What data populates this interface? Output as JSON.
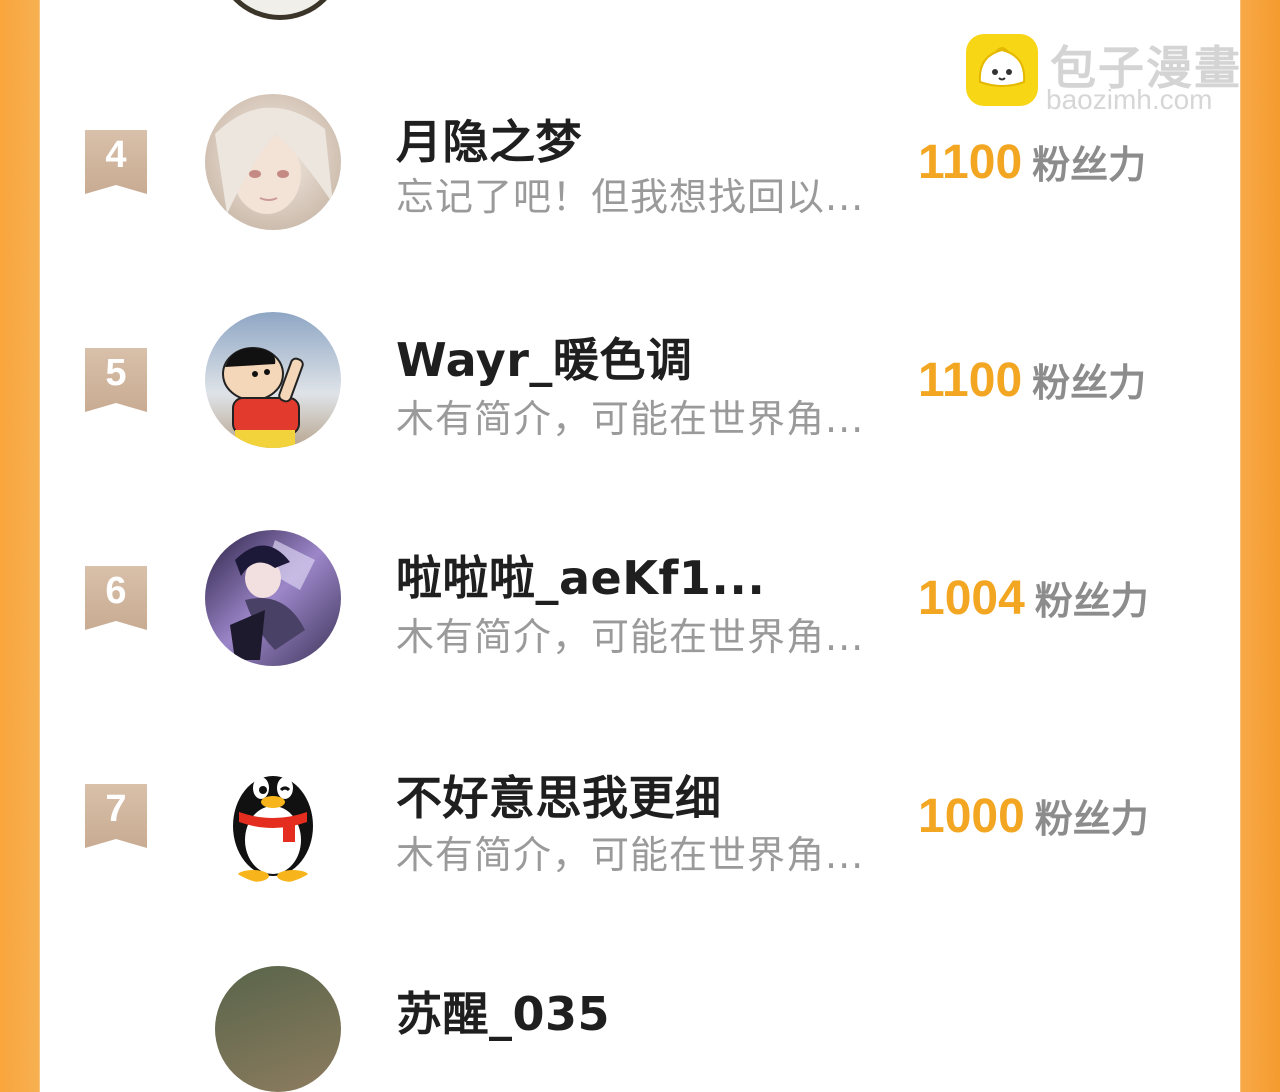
{
  "watermark": {
    "title": "包子漫畫",
    "domain": "baozimh.com"
  },
  "fans_label": "粉丝力",
  "rows": [
    {
      "rank": "4",
      "name": "月隐之梦",
      "bio": "忘记了吧！但我想找回以...",
      "fans": "1100",
      "avatar": "anime-girl-white-hair-avatar"
    },
    {
      "rank": "5",
      "name": "Wayr_暖色调",
      "bio": "木有简介，可能在世界角...",
      "fans": "1100",
      "avatar": "crayon-shinchan-avatar"
    },
    {
      "rank": "6",
      "name": "啦啦啦_aeKf1...",
      "bio": "木有简介，可能在世界角...",
      "fans": "1004",
      "avatar": "anime-character-purple-avatar"
    },
    {
      "rank": "7",
      "name": "不好意思我更细",
      "bio": "木有简介，可能在世界角...",
      "fans": "1000",
      "avatar": "qq-penguin-avatar"
    }
  ],
  "partial_row": {
    "name": "苏醒_035"
  }
}
